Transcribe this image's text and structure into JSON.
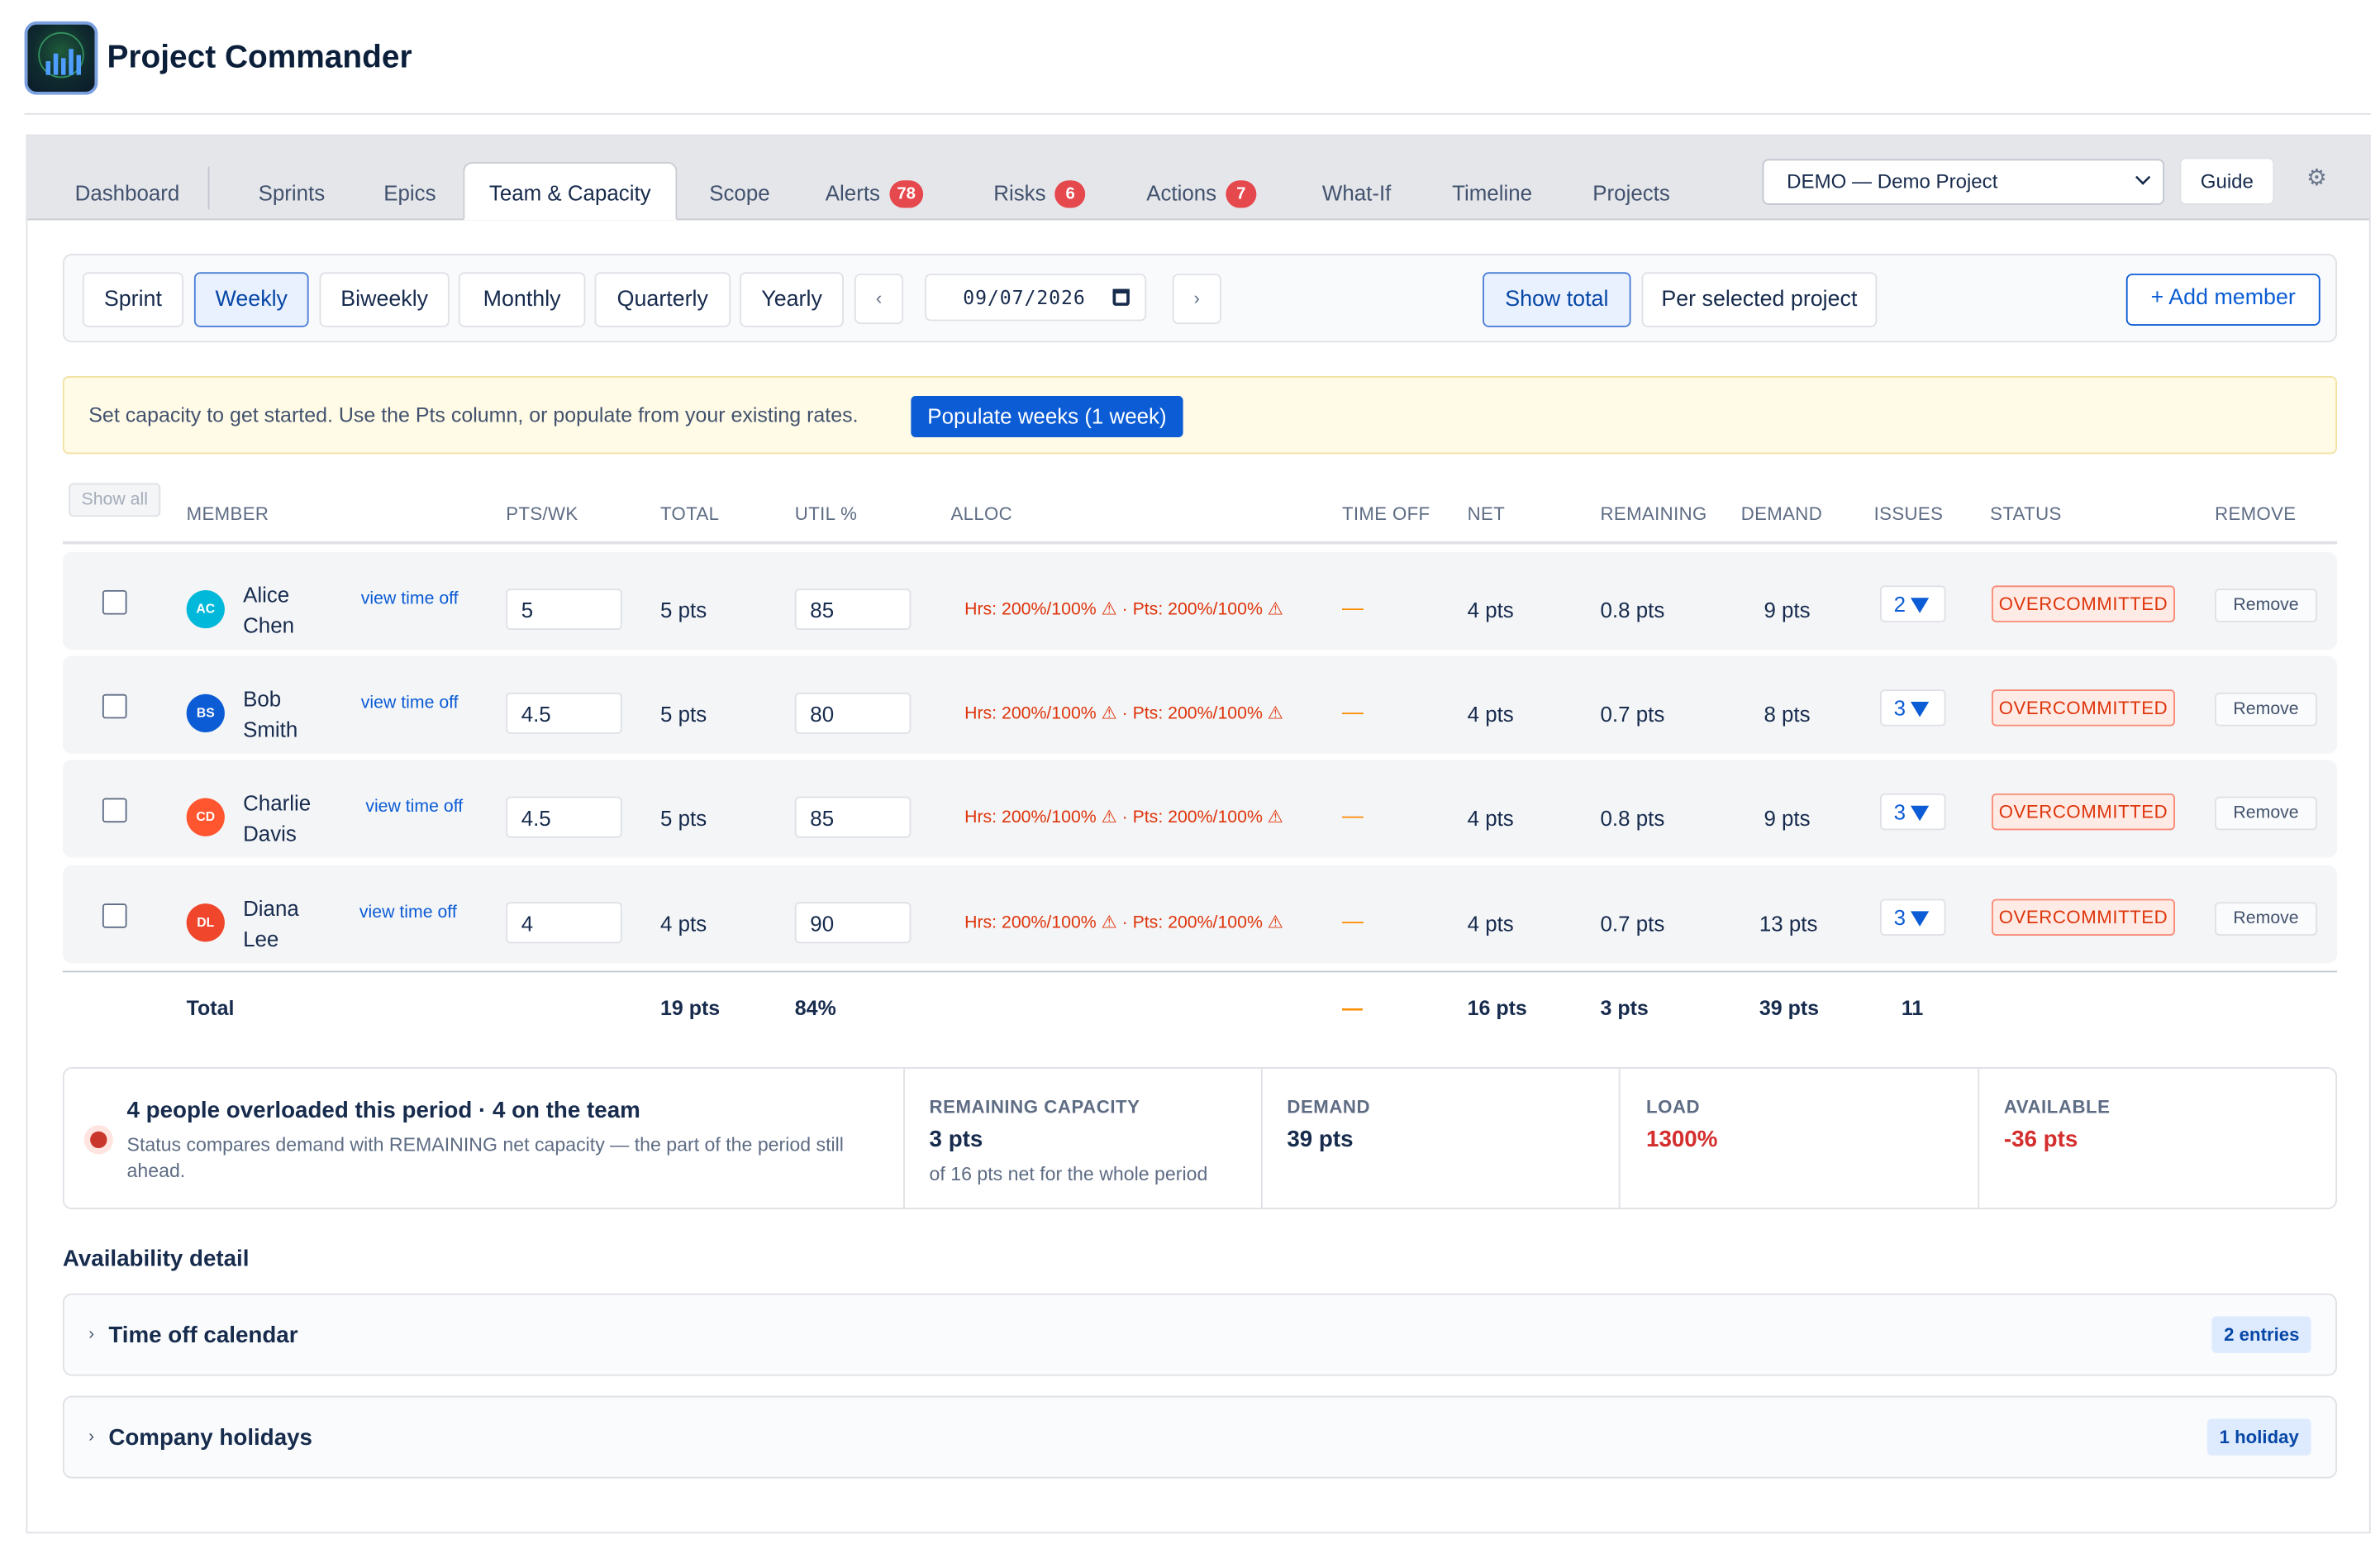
{
  "app": {
    "title": "Project Commander"
  },
  "tabs": [
    {
      "label": "Dashboard"
    },
    {
      "label": "Sprints"
    },
    {
      "label": "Epics"
    },
    {
      "label": "Team & Capacity",
      "active": true
    },
    {
      "label": "Scope"
    },
    {
      "label": "Alerts",
      "badge": "78"
    },
    {
      "label": "Risks",
      "badge": "6"
    },
    {
      "label": "Actions",
      "badge": "7"
    },
    {
      "label": "What-If"
    },
    {
      "label": "Timeline"
    },
    {
      "label": "Projects"
    }
  ],
  "header_controls": {
    "project_selected": "DEMO — Demo Project",
    "guide_label": "Guide",
    "settings_icon": "gear-icon"
  },
  "period": {
    "options": [
      "Sprint",
      "Weekly",
      "Biweekly",
      "Monthly",
      "Quarterly",
      "Yearly"
    ],
    "active": "Weekly",
    "prev_label": "‹",
    "next_label": "›",
    "date_value": "09/07/2026",
    "show_total_label": "Show total",
    "per_project_label": "Per selected project",
    "add_member_label": "+ Add member"
  },
  "banner": {
    "text": "Set capacity to get started. Use the Pts column, or populate from your existing rates.",
    "button_label": "Populate weeks (1 week)"
  },
  "table": {
    "show_all_label": "Show all",
    "headers": {
      "member": "MEMBER",
      "pts_wk": "PTS/WK",
      "total": "TOTAL",
      "util": "UTIL %",
      "alloc": "ALLOC",
      "time_off": "TIME OFF",
      "net": "NET",
      "remaining": "REMAINING",
      "demand": "DEMAND",
      "issues": "ISSUES",
      "status": "STATUS",
      "remove": "REMOVE"
    },
    "view_time_off_label": "view time off",
    "remove_label": "Remove",
    "rows": [
      {
        "initials": "AC",
        "first": "Alice",
        "last": "Chen",
        "avatar_color": "#00b8d9",
        "pts_wk": "5",
        "total": "5 pts",
        "util": "85",
        "alloc": "Hrs: 200%/100% ⚠ · Pts: 200%/100% ⚠",
        "time_off": "—",
        "net": "4 pts",
        "remaining": "0.8 pts",
        "demand": "9 pts",
        "issues": "2",
        "status": "OVERCOMMITTED"
      },
      {
        "initials": "BS",
        "first": "Bob",
        "last": "Smith",
        "avatar_color": "#0b5cd5",
        "pts_wk": "4.5",
        "total": "5 pts",
        "util": "80",
        "alloc": "Hrs: 200%/100% ⚠ · Pts: 200%/100% ⚠",
        "time_off": "—",
        "net": "4 pts",
        "remaining": "0.7 pts",
        "demand": "8 pts",
        "issues": "3",
        "status": "OVERCOMMITTED"
      },
      {
        "initials": "CD",
        "first": "Charlie",
        "last": "Davis",
        "avatar_color": "#ff5630",
        "pts_wk": "4.5",
        "total": "5 pts",
        "util": "85",
        "alloc": "Hrs: 200%/100% ⚠ · Pts: 200%/100% ⚠",
        "time_off": "—",
        "net": "4 pts",
        "remaining": "0.8 pts",
        "demand": "9 pts",
        "issues": "3",
        "status": "OVERCOMMITTED"
      },
      {
        "initials": "DL",
        "first": "Diana",
        "last": "Lee",
        "avatar_color": "#f0462c",
        "pts_wk": "4",
        "total": "4 pts",
        "util": "90",
        "alloc": "Hrs: 200%/100% ⚠ · Pts: 200%/100% ⚠",
        "time_off": "—",
        "net": "4 pts",
        "remaining": "0.7 pts",
        "demand": "13 pts",
        "issues": "3",
        "status": "OVERCOMMITTED"
      }
    ],
    "totals": {
      "label": "Total",
      "total": "19 pts",
      "util": "84%",
      "time_off": "—",
      "net": "16 pts",
      "remaining": "3 pts",
      "demand": "39 pts",
      "issues": "11"
    }
  },
  "summary": {
    "headline": "4 people overloaded this period · 4 on the team",
    "subtext": "Status compares demand with REMAINING net capacity — the part of the period still ahead.",
    "remaining": {
      "label": "REMAINING CAPACITY",
      "value": "3 pts",
      "sub": "of 16 pts net for the whole period"
    },
    "demand": {
      "label": "DEMAND",
      "value": "39 pts"
    },
    "load": {
      "label": "LOAD",
      "value": "1300%"
    },
    "available": {
      "label": "AVAILABLE",
      "value": "-36 pts"
    }
  },
  "availability": {
    "title": "Availability detail",
    "sections": [
      {
        "label": "Time off calendar",
        "pill": "2 entries"
      },
      {
        "label": "Company holidays",
        "pill": "1 holiday"
      }
    ]
  }
}
